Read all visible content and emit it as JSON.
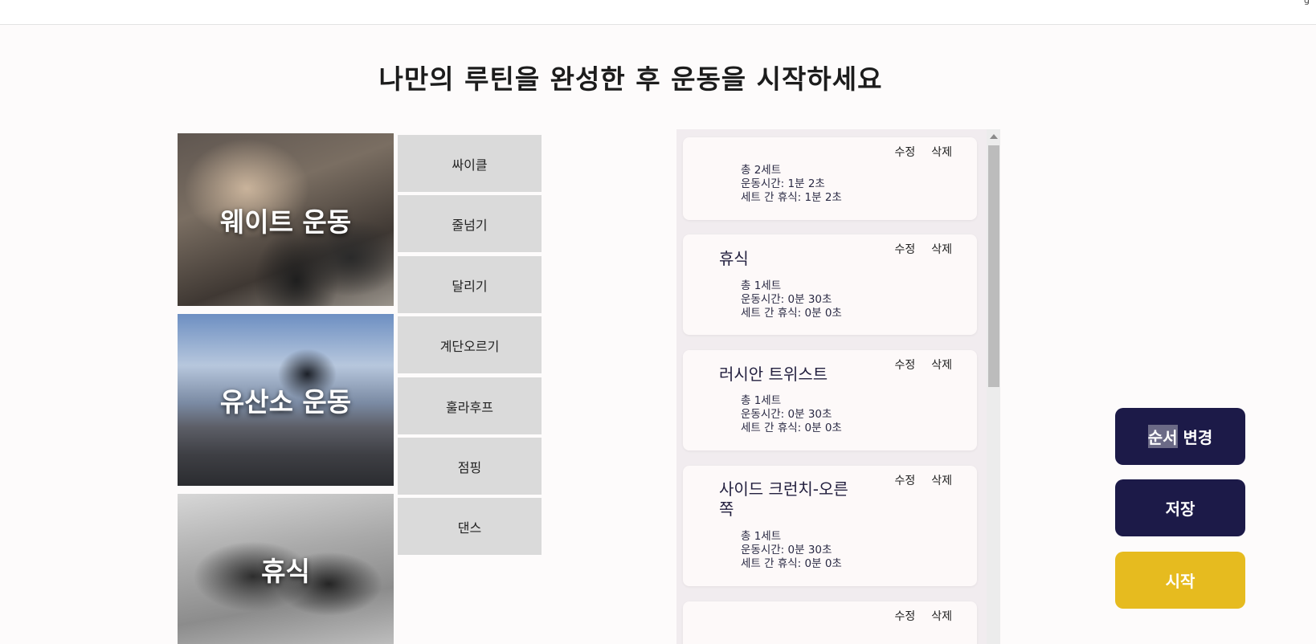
{
  "header": {
    "corner_glyph": "g"
  },
  "page": {
    "title": "나만의 루틴을 완성한 후 운동을 시작하세요"
  },
  "categories": [
    {
      "label": "웨이트 운동"
    },
    {
      "label": "유산소 운동"
    },
    {
      "label": "휴식"
    }
  ],
  "exercises": [
    "싸이클",
    "줄넘기",
    "달리기",
    "계단오르기",
    "훌라후프",
    "점핑",
    "댄스"
  ],
  "routine": {
    "edit_label": "수정",
    "delete_label": "삭제",
    "items": [
      {
        "name": "",
        "sets": "총 2세트",
        "duration": "운동시간: 1분 2초",
        "rest": "세트 간 휴식: 1분 2초"
      },
      {
        "name": "휴식",
        "sets": "총 1세트",
        "duration": "운동시간: 0분 30초",
        "rest": "세트 간 휴식: 0분 0초"
      },
      {
        "name": "러시안 트위스트",
        "sets": "총 1세트",
        "duration": "운동시간: 0분 30초",
        "rest": "세트 간 휴식: 0분 0초"
      },
      {
        "name": "사이드 크런치-오른쪽",
        "sets": "총 1세트",
        "duration": "운동시간: 0분 30초",
        "rest": "세트 간 휴식: 0분 0초"
      }
    ]
  },
  "actions": {
    "reorder_selected": "순서",
    "reorder_rest": " 변경",
    "save": "저장",
    "start": "시작"
  },
  "colors": {
    "primary": "#1c1a48",
    "accent": "#e6bb1f",
    "tile": "#dadada"
  }
}
